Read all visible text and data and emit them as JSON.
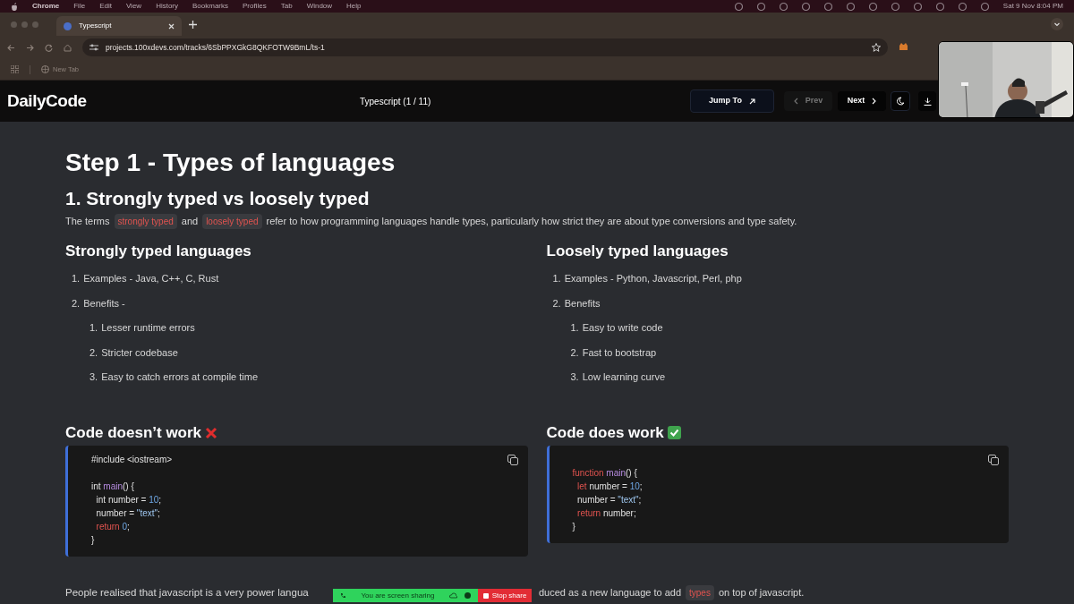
{
  "menubar": {
    "app": "Chrome",
    "menus": [
      "File",
      "Edit",
      "View",
      "History",
      "Bookmarks",
      "Profiles",
      "Tab",
      "Window",
      "Help"
    ],
    "clock": "Sat 9 Nov  8:04 PM"
  },
  "browser": {
    "tabs": [
      {
        "title": "Typescript",
        "selected": true
      }
    ],
    "url": "projects.100xdevs.com/tracks/6SbPPXGkG8QKFOTW9BmL/ts-1",
    "bookmarks": [
      "New Tab"
    ]
  },
  "header": {
    "logo": "DailyCode",
    "title": "Typescript (1 / 11)",
    "jump": "Jump To",
    "prev": {
      "label": "Prev",
      "disabled": true
    },
    "next": {
      "label": "Next",
      "disabled": false
    }
  },
  "content": {
    "title": "Step 1 - Types of languages",
    "subtitle": "1. Strongly typed vs loosely typed",
    "intro": [
      {
        "kind": "text",
        "t": "The terms"
      },
      {
        "kind": "code",
        "t": "strongly typed"
      },
      {
        "kind": "text",
        "t": "and"
      },
      {
        "kind": "code",
        "t": "loosely typed"
      },
      {
        "kind": "text",
        "t": "refer to how programming languages handle types, particularly how strict they are about type conversions and type safety."
      }
    ],
    "columns": [
      {
        "heading": "Strongly typed languages",
        "items": [
          {
            "number": "1.",
            "text": "Examples - Java, C++, C, Rust"
          },
          {
            "number": "2.",
            "text": "Benefits -",
            "children": [
              {
                "number": "1.",
                "text": "Lesser runtime errors"
              },
              {
                "number": "2.",
                "text": "Stricter codebase"
              },
              {
                "number": "3.",
                "text": "Easy to catch errors at compile time"
              }
            ]
          }
        ]
      },
      {
        "heading": "Loosely typed languages",
        "items": [
          {
            "number": "1.",
            "text": "Examples - Python, Javascript, Perl, php"
          },
          {
            "number": "2.",
            "text": "Benefits",
            "children": [
              {
                "number": "1.",
                "text": "Easy to write code"
              },
              {
                "number": "2.",
                "text": "Fast to bootstrap"
              },
              {
                "number": "3.",
                "text": "Low learning curve"
              }
            ]
          }
        ]
      }
    ],
    "examples": [
      {
        "heading": "Code doesn’t work",
        "works": false,
        "lines": [
          {
            "spaced": false,
            "tokens": [
              {
                "kind": "plain",
                "t": "#include <iostream>"
              }
            ]
          },
          {
            "spaced": true,
            "tokens": [
              {
                "kind": "plain",
                "t": "int "
              },
              {
                "kind": "func",
                "t": "main"
              },
              {
                "kind": "plain",
                "t": "() {"
              }
            ]
          },
          {
            "spaced": false,
            "tokens": [
              {
                "kind": "plain",
                "t": "  int number = "
              },
              {
                "kind": "number",
                "t": "10"
              },
              {
                "kind": "plain",
                "t": ";"
              }
            ]
          },
          {
            "spaced": false,
            "tokens": [
              {
                "kind": "plain",
                "t": "  number = "
              },
              {
                "kind": "string",
                "t": "\"text\""
              },
              {
                "kind": "plain",
                "t": ";"
              }
            ]
          },
          {
            "spaced": false,
            "tokens": [
              {
                "kind": "keyword",
                "t": "  return "
              },
              {
                "kind": "number",
                "t": "0"
              },
              {
                "kind": "plain",
                "t": ";"
              }
            ]
          },
          {
            "spaced": false,
            "tokens": [
              {
                "kind": "plain",
                "t": "}"
              }
            ]
          }
        ]
      },
      {
        "heading": "Code does work",
        "works": true,
        "lines": [
          {
            "spaced": true,
            "tokens": [
              {
                "kind": "keyword",
                "t": "function "
              },
              {
                "kind": "func",
                "t": "main"
              },
              {
                "kind": "plain",
                "t": "() {"
              }
            ]
          },
          {
            "spaced": false,
            "tokens": [
              {
                "kind": "keyword",
                "t": "  let "
              },
              {
                "kind": "plain",
                "t": "number = "
              },
              {
                "kind": "number",
                "t": "10"
              },
              {
                "kind": "plain",
                "t": ";"
              }
            ]
          },
          {
            "spaced": false,
            "tokens": [
              {
                "kind": "plain",
                "t": "  number = "
              },
              {
                "kind": "string",
                "t": "\"text\""
              },
              {
                "kind": "plain",
                "t": ";"
              }
            ]
          },
          {
            "spaced": false,
            "tokens": [
              {
                "kind": "keyword",
                "t": "  return "
              },
              {
                "kind": "plain",
                "t": "number;"
              }
            ]
          },
          {
            "spaced": false,
            "tokens": [
              {
                "kind": "plain",
                "t": "}"
              }
            ]
          }
        ]
      }
    ],
    "footer_left": "People realised that javascript is a very power langua",
    "footer_right": [
      {
        "kind": "text",
        "t": "duced as a new language to add"
      },
      {
        "kind": "code",
        "t": "types"
      },
      {
        "kind": "text",
        "t": "on top of javascript."
      }
    ]
  },
  "share_bar": {
    "text": "You are screen sharing",
    "stop": "Stop share"
  }
}
